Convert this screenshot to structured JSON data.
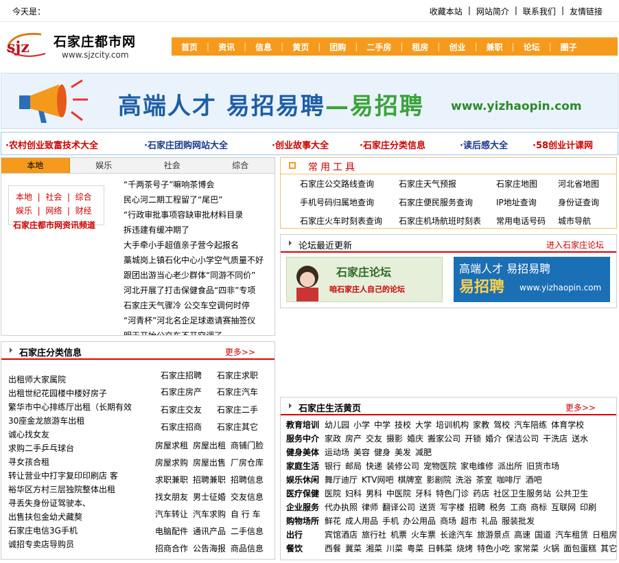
{
  "topbar": {
    "today_label": "今天是：",
    "links": [
      "收藏本站",
      "网站简介",
      "联系我们",
      "友情链接"
    ]
  },
  "logo": {
    "mark": "sjz",
    "name": "石家庄都市网",
    "url": "www.sjzcity.com"
  },
  "nav": [
    "首页",
    "资讯",
    "信息",
    "黄页",
    "团购",
    "二手房",
    "租房",
    "创业",
    "兼职",
    "论坛",
    "圈子"
  ],
  "banner": {
    "text_a": "高端人才  易招易聘",
    "text_b": "—易招聘",
    "url": "www.yizhaopin.com"
  },
  "linkbar": [
    "·农村创业致富技术大全",
    "·石家庄团购网站大全",
    "·创业故事大全",
    "·石家庄分类信息",
    "·读后感大全",
    "·58创业计课网"
  ],
  "news": {
    "tabs": [
      "本地",
      "娱乐",
      "社会",
      "综合"
    ],
    "box_rows": [
      [
        "本地",
        "社会",
        "综合"
      ],
      [
        "娱乐",
        "网络",
        "财经"
      ]
    ],
    "box_title": "石家庄都市网资讯频道",
    "items": [
      "“千两茶号子”嘛响茶博会",
      "民心河二期工程留了“尾巴”",
      "“行政审批事项容缺审批材料目录",
      "拆违建有缓冲期了",
      "大手牵小手超值亲子营今起报名",
      "藁城岗上镇石化中心小学空气质量不好",
      "跟团出游当心老少群体“同游不同价”",
      "河北开展了打击保健食品“四非”专项",
      "石家庄天气骤冷 公交车空调何时停",
      "“河青杯”河北名企足球邀请赛抽签仪",
      "明天开始公交车不开空调了"
    ]
  },
  "tools": {
    "title": "常用工具",
    "items": [
      [
        "石家庄公交路线查询",
        "石家庄天气预报",
        "石家庄地图",
        "河北省地图"
      ],
      [
        "手机号码归属地查询",
        "石家庄便民服务查询",
        "IP地址查询",
        "身份证查询"
      ],
      [
        "石家庄火车时刻表查询",
        "石家庄机场航班时刻表",
        "常用电话号码",
        "城市导航"
      ]
    ]
  },
  "forum": {
    "title": "论坛最近更新",
    "link": "进入石家庄论坛",
    "img1_title": "石家庄论坛",
    "img1_sub": "咱石家庄人自己的论坛",
    "img2_line1": "高端人才 易招易聘",
    "img2_line2": "易招聘",
    "img2_url": "www.yizhaopin.com"
  },
  "classified": {
    "title": "石家庄分类信息",
    "more": "更多>>",
    "items": [
      "出租师大家属院",
      "出租世纪花园楼中楼好房子",
      "繁华市中心排练厅出租（长期有效",
      "30座金龙旅游车出租",
      "诚心找女友",
      "求购二手乒乓球台",
      "寻女孩合租",
      "转让营业中打字复印印刷店 客",
      "裕华区方村三层独院整体出租",
      "寻丢失身份证驾驶本、",
      "出售扶包金幼犬藏獒",
      "石家庄电信3G手机",
      "诚招专卖店导购员"
    ],
    "cats_a": [
      [
        "石家庄招聘",
        "石家庄求职"
      ],
      [
        "石家庄房产",
        "石家庄汽车"
      ],
      [
        "石家庄交友",
        "石家庄二手"
      ],
      [
        "石家庄招商",
        "石家庄其它"
      ]
    ],
    "cats_b": [
      [
        "房屋求租",
        "房屋出租",
        "商铺门脸"
      ],
      [
        "房屋求购",
        "房屋出售",
        "厂房仓库"
      ],
      [
        "求职兼职",
        "招聘兼职",
        "招聘信息"
      ],
      [
        "找女朋友",
        "男士征婚",
        "交友信息"
      ],
      [
        "汽车转让",
        "汽车求购",
        "自 行 车"
      ],
      [
        "电脑配件",
        "通讯产品",
        "二手信息"
      ],
      [
        "招商合作",
        "公告海报",
        "商品信息"
      ]
    ]
  },
  "yellow": {
    "title": "石家庄生活黄页",
    "more": "更多>>",
    "rows": [
      {
        "cat": "教育培训",
        "items": [
          "幼儿园",
          "小学",
          "中学",
          "技校",
          "大学",
          "培训机构",
          "家教",
          "驾校",
          "汽车陪练",
          "体育学校"
        ]
      },
      {
        "cat": "服务中介",
        "items": [
          "家政",
          "房产",
          "交友",
          "摄影",
          "婚庆",
          "搬家公司",
          "开锁",
          "婚介",
          "保洁公司",
          "干洗店",
          "送水"
        ]
      },
      {
        "cat": "健身美体",
        "items": [
          "运动场",
          "美容",
          "健身",
          "美发",
          "减肥"
        ]
      },
      {
        "cat": "家庭生活",
        "items": [
          "银行",
          "邮局",
          "快递",
          "装修公司",
          "宠物医院",
          "家电维修",
          "派出所",
          "旧货市场"
        ]
      },
      {
        "cat": "娱乐休闲",
        "items": [
          "舞厅迪厅",
          "KTV网吧",
          "棋牌室",
          "影剧院",
          "洗浴",
          "茶室",
          "咖啡厅",
          "酒吧"
        ]
      },
      {
        "cat": "医疗保健",
        "items": [
          "医院",
          "妇科",
          "男科",
          "中医院",
          "牙科",
          "特色门诊",
          "药店",
          "社区卫生服务站",
          "公共卫生"
        ]
      },
      {
        "cat": "企业服务",
        "items": [
          "代办执照",
          "律师",
          "翻译公司",
          "送货",
          "写字楼",
          "招聘",
          "税务",
          "工商",
          "商标",
          "互联网",
          "印刷"
        ]
      },
      {
        "cat": "购物场所",
        "items": [
          "鲜花",
          "成人用品",
          "手机",
          "办公用品",
          "商场",
          "超市",
          "礼品",
          "服装批发"
        ]
      },
      {
        "cat": "出行",
        "items": [
          "宾馆酒店",
          "旅行社",
          "机票",
          "火车票",
          "长途汽车",
          "旅游景点",
          "高速",
          "国道",
          "汽车租赁",
          "日租房"
        ]
      },
      {
        "cat": "餐饮",
        "items": [
          "西餐",
          "冀菜",
          "湘菜",
          "川菜",
          "粤菜",
          "日韩菜",
          "烧烤",
          "特色小吃",
          "家常菜",
          "火锅",
          "面包蛋糕",
          "其它"
        ]
      }
    ]
  },
  "colors": {
    "accent": "#f59a1c",
    "red": "#cc0000",
    "blue": "#1e5fa5"
  }
}
